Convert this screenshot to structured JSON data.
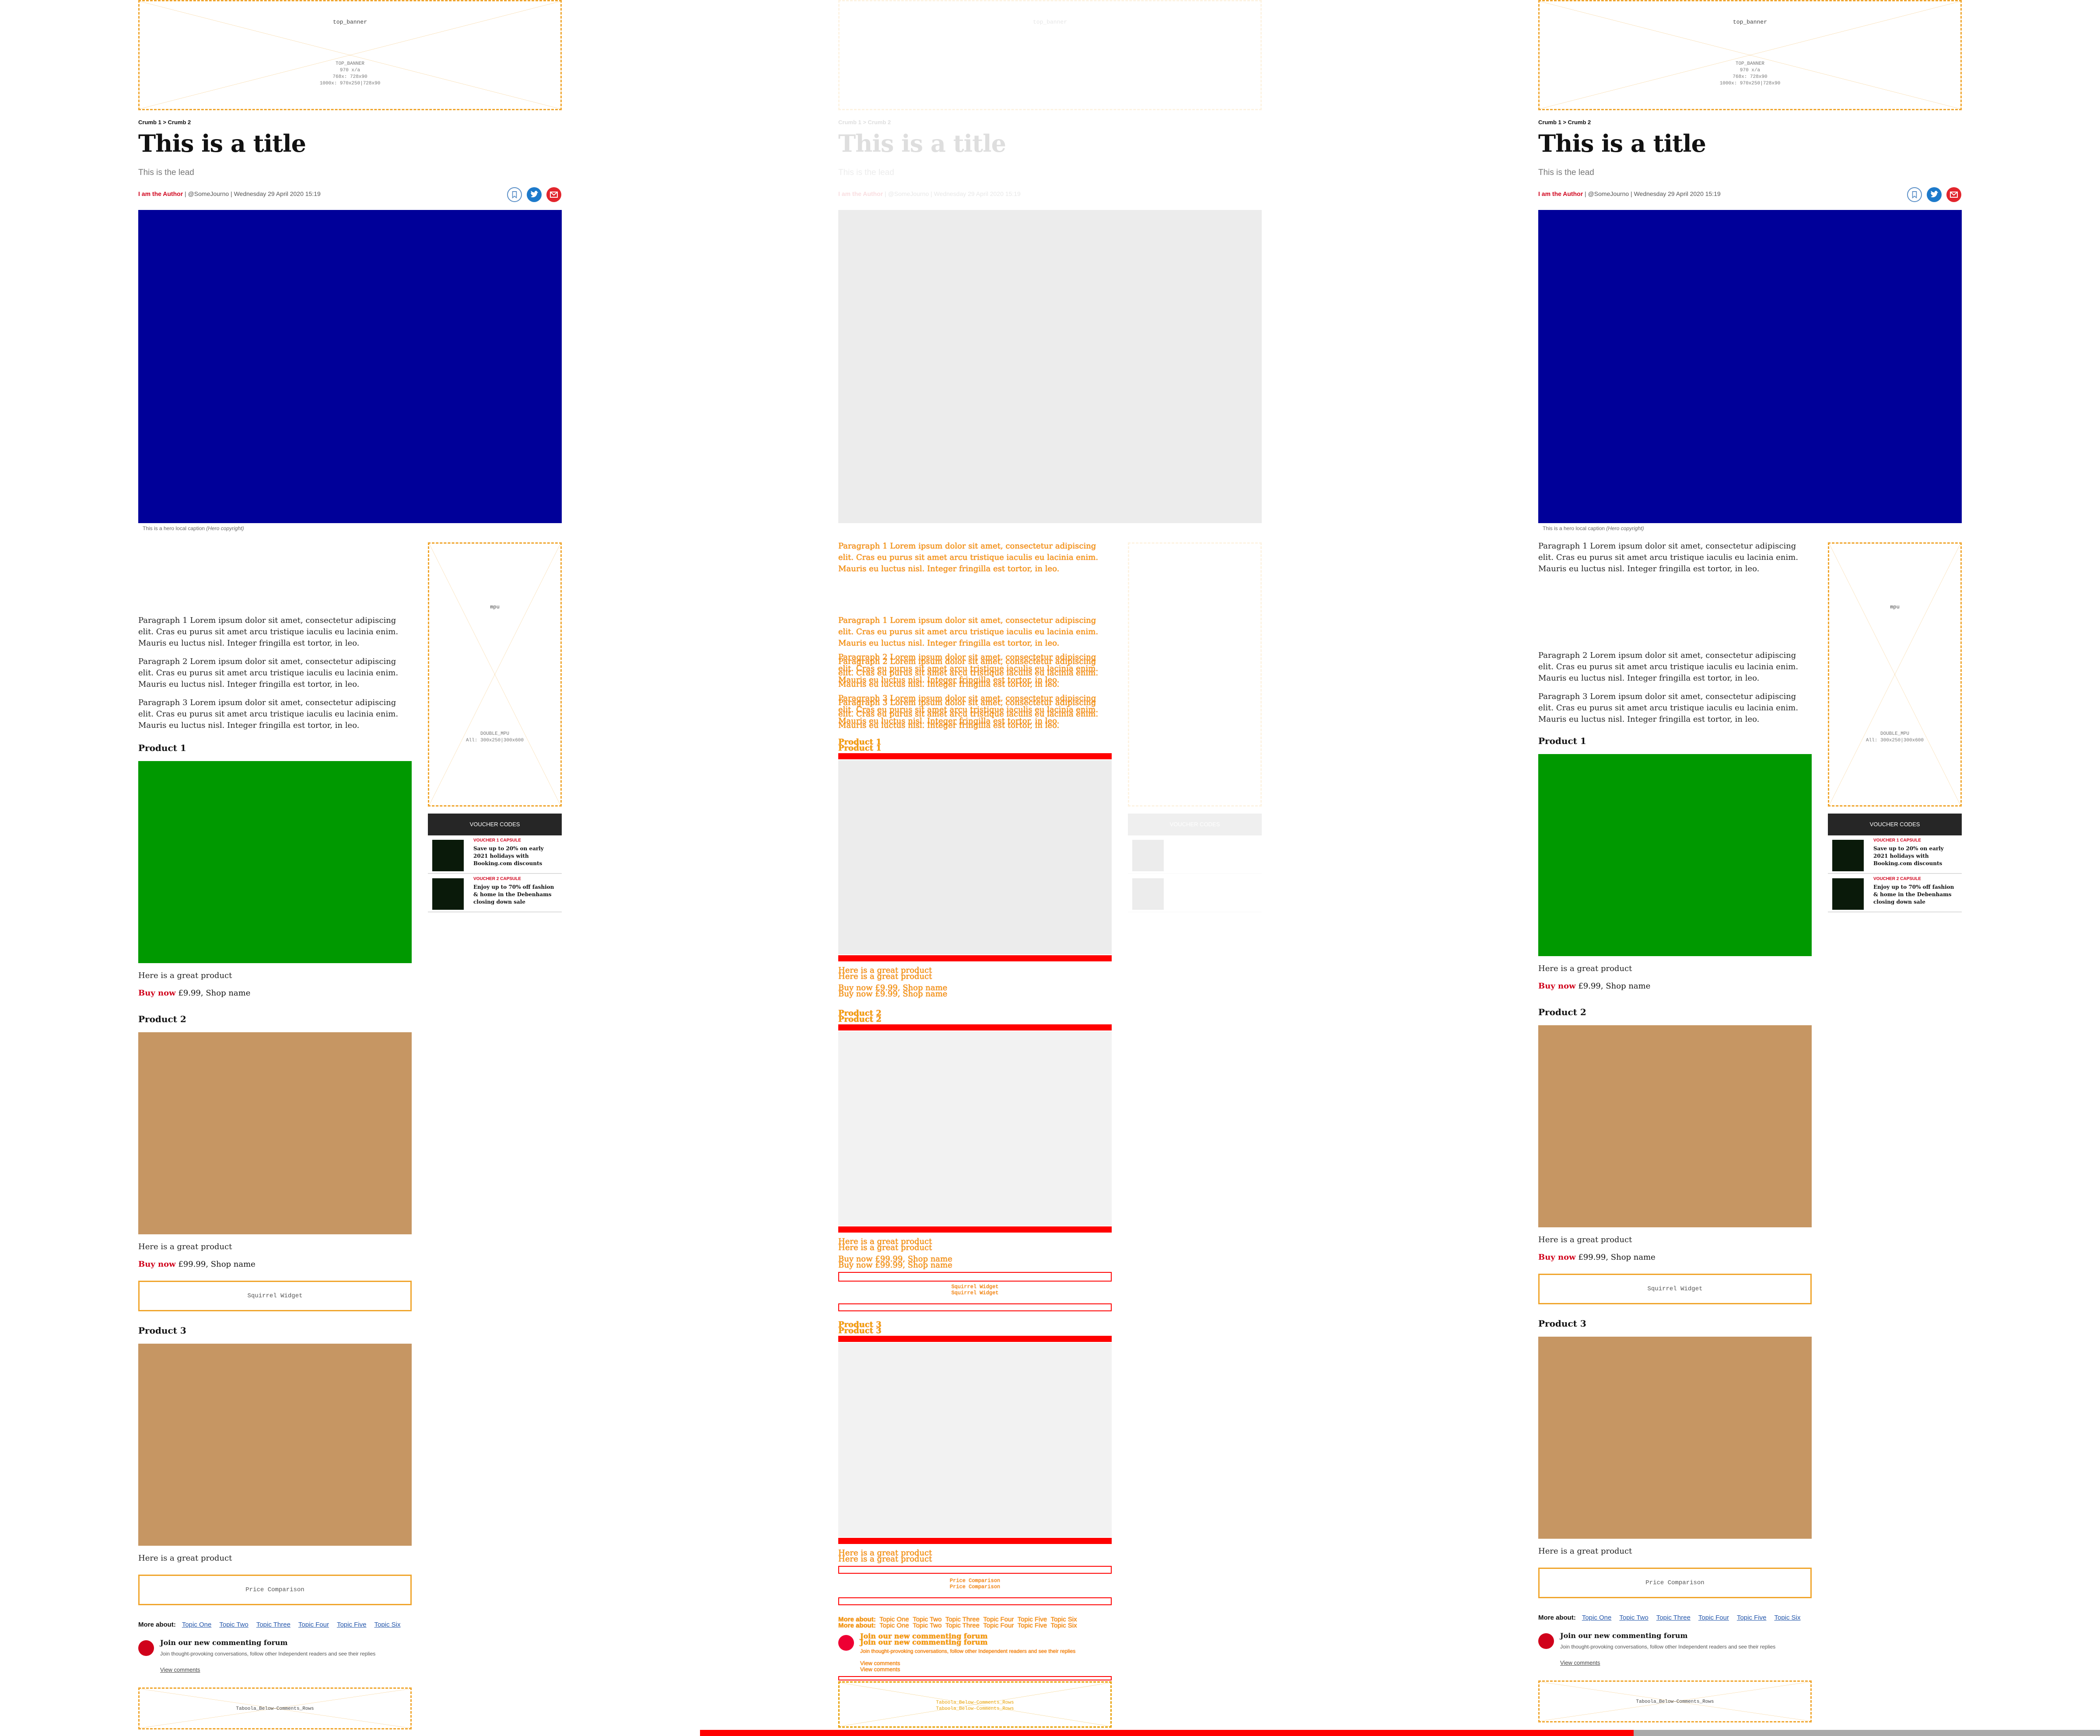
{
  "placeholders": {
    "top_banner": {
      "name": "top_banner",
      "detail": "TOP_BANNER\n970 x/a\n768x: 728x90\n1000x: 970x250|728x90"
    },
    "mpu": {
      "name": "mpu",
      "detail": "DOUBLE_MPU\nAll: 300x250|300x600"
    },
    "taboola": {
      "name": "Taboola_Below-Comments_Rows"
    }
  },
  "breadcrumb": "Crumb 1 > Crumb 2",
  "title": "This is a title",
  "lead": "This is the lead",
  "byline": {
    "author": "I am the Author",
    "rest": " | @SomeJourno | Wednesday 29 April 2020 15:19"
  },
  "share_icons": [
    "bookmark-icon",
    "twitter-icon",
    "email-icon"
  ],
  "hero": {
    "color": "#000099",
    "caption": "This is a hero local caption",
    "copyright": "(Hero copyright)"
  },
  "paragraphs": [
    "Paragraph 1 Lorem ipsum dolor sit amet, consectetur adipiscing elit. Cras eu purus sit amet arcu tristique iaculis eu lacinia enim. Mauris eu luctus nisl. Integer fringilla est tortor, in leo.",
    "Paragraph 2 Lorem ipsum dolor sit amet, consectetur adipiscing elit. Cras eu purus sit amet arcu tristique iaculis eu lacinia enim. Mauris eu luctus nisl. Integer fringilla est tortor, in leo.",
    "Paragraph 3 Lorem ipsum dolor sit amet, consectetur adipiscing elit. Cras eu purus sit amet arcu tristique iaculis eu lacinia enim. Mauris eu luctus nisl. Integer fringilla est tortor, in leo."
  ],
  "products": [
    {
      "title": "Product 1",
      "color": "#009900",
      "desc": "Here is a great product",
      "buy": "Buy now",
      "price": " £9.99, Shop name"
    },
    {
      "title": "Product 2",
      "color": "#c69663",
      "desc": "Here is a great product",
      "buy": "Buy now",
      "price": " £99.99, Shop name"
    },
    {
      "title": "Product 3",
      "color": "#c69663",
      "desc": "Here is a great product"
    }
  ],
  "widgets": {
    "squirrel": "Squirrel Widget",
    "price": "Price Comparison"
  },
  "vouchers": {
    "header": "VOUCHER CODES",
    "items": [
      {
        "label": "VOUCHER 1 CAPSULE",
        "text": "Save up to 20% on early 2021 holidays with Booking.com discounts"
      },
      {
        "label": "VOUCHER 2 CAPSULE",
        "text": "Enjoy up to 70% off fashion & home in the Debenhams closing down sale"
      }
    ]
  },
  "more_about": {
    "label": "More about:",
    "topics": [
      "Topic One",
      "Topic Two",
      "Topic Three",
      "Topic Four",
      "Topic Five",
      "Topic Six"
    ]
  },
  "comments": {
    "title": "Join our new commenting forum",
    "sub": "Join thought-provoking conversations, follow other Independent readers and see their replies",
    "view": "View comments"
  },
  "progress": {
    "fraction": 0.667,
    "fill_color": "#ff0000",
    "track_color": "#aaaaaa"
  }
}
